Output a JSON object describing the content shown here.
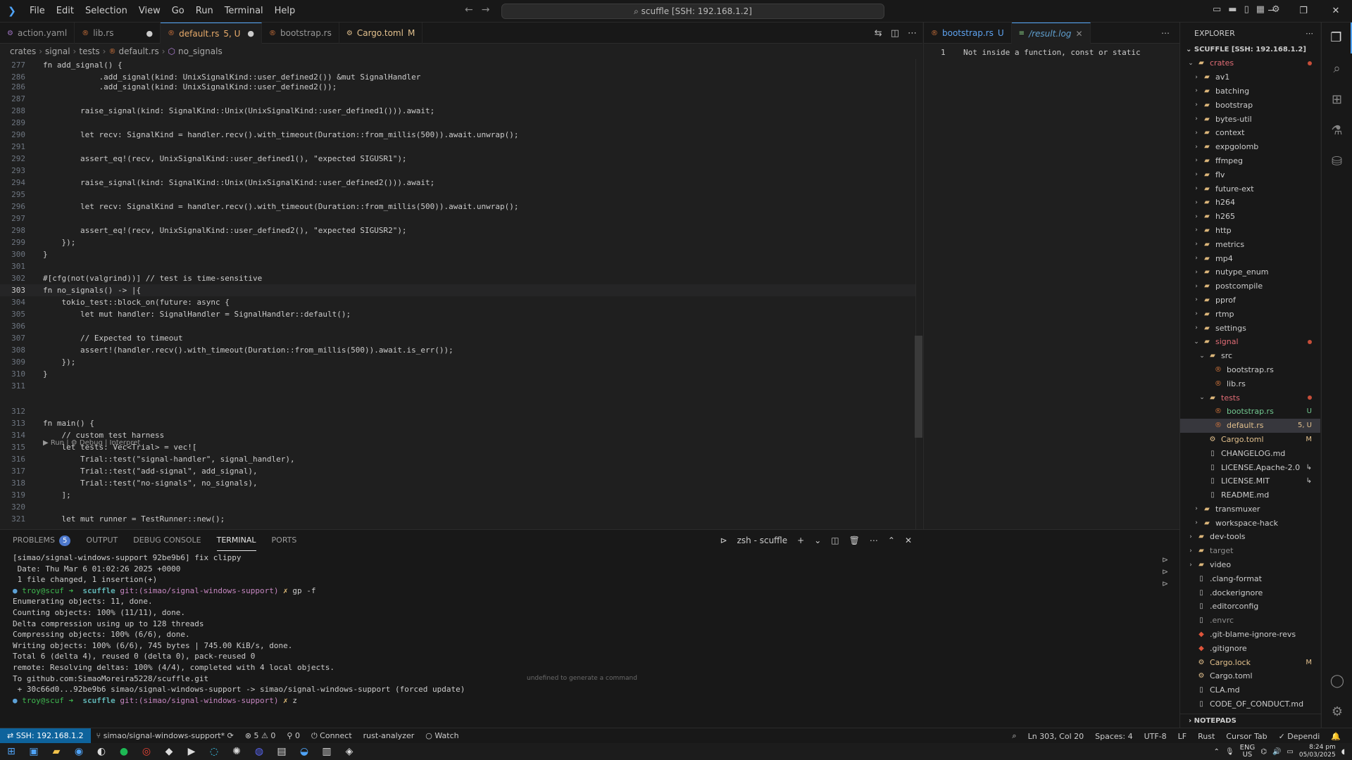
{
  "titlebar": {
    "menu": [
      "File",
      "Edit",
      "Selection",
      "View",
      "Go",
      "Run",
      "Terminal",
      "Help"
    ],
    "command_center": "scuffle [SSH: 192.168.1.2]"
  },
  "editor1": {
    "tabs": [
      {
        "label": "action.yaml",
        "suffix": ""
      },
      {
        "label": "lib.rs",
        "suffix": ""
      },
      {
        "label": "default.rs",
        "suffix": "5, U"
      },
      {
        "label": "bootstrap.rs",
        "suffix": ""
      },
      {
        "label": "Cargo.toml",
        "suffix": "M"
      }
    ],
    "breadcrumb": [
      "crates",
      "signal",
      "tests",
      "default.rs",
      "no_signals"
    ],
    "lines": [
      {
        "n": "277",
        "t": "fn add_signal() {"
      },
      {
        "n": "286",
        "t": "            .add_signal(kind: UnixSignalKind::user_defined2()) &mut SignalHandler"
      },
      {
        "n": "286",
        "t": "            .add_signal(kind: UnixSignalKind::user_defined2());"
      },
      {
        "n": "287",
        "t": ""
      },
      {
        "n": "288",
        "t": "        raise_signal(kind: SignalKind::Unix(UnixSignalKind::user_defined1())).await;"
      },
      {
        "n": "289",
        "t": ""
      },
      {
        "n": "290",
        "t": "        let recv: SignalKind = handler.recv().with_timeout(Duration::from_millis(500)).await.unwrap();"
      },
      {
        "n": "291",
        "t": ""
      },
      {
        "n": "292",
        "t": "        assert_eq!(recv, UnixSignalKind::user_defined1(), \"expected SIGUSR1\");"
      },
      {
        "n": "293",
        "t": ""
      },
      {
        "n": "294",
        "t": "        raise_signal(kind: SignalKind::Unix(UnixSignalKind::user_defined2())).await;"
      },
      {
        "n": "295",
        "t": ""
      },
      {
        "n": "296",
        "t": "        let recv: SignalKind = handler.recv().with_timeout(Duration::from_millis(500)).await.unwrap();"
      },
      {
        "n": "297",
        "t": ""
      },
      {
        "n": "298",
        "t": "        assert_eq!(recv, UnixSignalKind::user_defined2(), \"expected SIGUSR2\");"
      },
      {
        "n": "299",
        "t": "    });"
      },
      {
        "n": "300",
        "t": "}"
      },
      {
        "n": "301",
        "t": ""
      },
      {
        "n": "302",
        "t": "#[cfg(not(valgrind))] // test is time-sensitive"
      },
      {
        "n": "303",
        "t": "fn no_signals() -> |{"
      },
      {
        "n": "304",
        "t": "    tokio_test::block_on(future: async {"
      },
      {
        "n": "305",
        "t": "        let mut handler: SignalHandler = SignalHandler::default();"
      },
      {
        "n": "306",
        "t": ""
      },
      {
        "n": "307",
        "t": "        // Expected to timeout"
      },
      {
        "n": "308",
        "t": "        assert!(handler.recv().with_timeout(Duration::from_millis(500)).await.is_err());"
      },
      {
        "n": "309",
        "t": "    });"
      },
      {
        "n": "310",
        "t": "}"
      },
      {
        "n": "311",
        "t": ""
      },
      {
        "n": "312",
        "t": ""
      },
      {
        "n": "313",
        "t": "fn main() {"
      },
      {
        "n": "314",
        "t": "    // custom test harness"
      },
      {
        "n": "315",
        "t": "    let tests: Vec<Trial> = vec!["
      },
      {
        "n": "316",
        "t": "        Trial::test(\"signal-handler\", signal_handler),"
      },
      {
        "n": "317",
        "t": "        Trial::test(\"add-signal\", add_signal),"
      },
      {
        "n": "318",
        "t": "        Trial::test(\"no-signals\", no_signals),"
      },
      {
        "n": "319",
        "t": "    ];"
      },
      {
        "n": "320",
        "t": ""
      },
      {
        "n": "321",
        "t": "    let mut runner = TestRunner::new();"
      }
    ],
    "codelens": "▶ Run | ⚙ Debug | Interpret"
  },
  "editor2": {
    "tabs": [
      {
        "label": "bootstrap.rs",
        "suffix": "U"
      },
      {
        "label": "/result.log",
        "suffix": ""
      }
    ],
    "line_number": "1",
    "line_text": "Not inside a function, const or static"
  },
  "explorer": {
    "title": "EXPLORER",
    "root": "SCUFFLE [SSH: 192.168.1.2]",
    "items": [
      {
        "label": "crates",
        "depth": 0,
        "kind": "folder-open",
        "badge": "dot",
        "color": "#e06c75"
      },
      {
        "label": "av1",
        "depth": 1,
        "kind": "folder",
        "badge": ""
      },
      {
        "label": "batching",
        "depth": 1,
        "kind": "folder",
        "badge": ""
      },
      {
        "label": "bootstrap",
        "depth": 1,
        "kind": "folder",
        "badge": ""
      },
      {
        "label": "bytes-util",
        "depth": 1,
        "kind": "folder",
        "badge": ""
      },
      {
        "label": "context",
        "depth": 1,
        "kind": "folder",
        "badge": ""
      },
      {
        "label": "expgolomb",
        "depth": 1,
        "kind": "folder",
        "badge": ""
      },
      {
        "label": "ffmpeg",
        "depth": 1,
        "kind": "folder",
        "badge": ""
      },
      {
        "label": "flv",
        "depth": 1,
        "kind": "folder",
        "badge": ""
      },
      {
        "label": "future-ext",
        "depth": 1,
        "kind": "folder",
        "badge": ""
      },
      {
        "label": "h264",
        "depth": 1,
        "kind": "folder",
        "badge": ""
      },
      {
        "label": "h265",
        "depth": 1,
        "kind": "folder",
        "badge": ""
      },
      {
        "label": "http",
        "depth": 1,
        "kind": "folder",
        "badge": ""
      },
      {
        "label": "metrics",
        "depth": 1,
        "kind": "folder",
        "badge": ""
      },
      {
        "label": "mp4",
        "depth": 1,
        "kind": "folder",
        "badge": ""
      },
      {
        "label": "nutype_enum",
        "depth": 1,
        "kind": "folder",
        "badge": ""
      },
      {
        "label": "postcompile",
        "depth": 1,
        "kind": "folder",
        "badge": ""
      },
      {
        "label": "pprof",
        "depth": 1,
        "kind": "folder",
        "badge": ""
      },
      {
        "label": "rtmp",
        "depth": 1,
        "kind": "folder",
        "badge": ""
      },
      {
        "label": "settings",
        "depth": 1,
        "kind": "folder",
        "badge": ""
      },
      {
        "label": "signal",
        "depth": 1,
        "kind": "folder-open",
        "badge": "dot",
        "color": "#e06c75"
      },
      {
        "label": "src",
        "depth": 2,
        "kind": "folder-open",
        "badge": ""
      },
      {
        "label": "bootstrap.rs",
        "depth": 3,
        "kind": "rust",
        "badge": ""
      },
      {
        "label": "lib.rs",
        "depth": 3,
        "kind": "rust",
        "badge": ""
      },
      {
        "label": "tests",
        "depth": 2,
        "kind": "folder-open",
        "badge": "dot",
        "color": "#e06c75"
      },
      {
        "label": "bootstrap.rs",
        "depth": 3,
        "kind": "rust",
        "badge": "U",
        "color": "#73c991"
      },
      {
        "label": "default.rs",
        "depth": 3,
        "kind": "rust",
        "badge": "5, U",
        "color": "#e2c08d"
      },
      {
        "label": "Cargo.toml",
        "depth": 2,
        "kind": "toml",
        "badge": "M",
        "color": "#e2c08d"
      },
      {
        "label": "CHANGELOG.md",
        "depth": 2,
        "kind": "file",
        "badge": ""
      },
      {
        "label": "LICENSE.Apache-2.0",
        "depth": 2,
        "kind": "file",
        "badge": "↳"
      },
      {
        "label": "LICENSE.MIT",
        "depth": 2,
        "kind": "file",
        "badge": "↳"
      },
      {
        "label": "README.md",
        "depth": 2,
        "kind": "file",
        "badge": ""
      },
      {
        "label": "transmuxer",
        "depth": 1,
        "kind": "folder",
        "badge": ""
      },
      {
        "label": "workspace-hack",
        "depth": 1,
        "kind": "folder",
        "badge": ""
      },
      {
        "label": "dev-tools",
        "depth": 0,
        "kind": "folder",
        "badge": ""
      },
      {
        "label": "target",
        "depth": 0,
        "kind": "folder",
        "badge": "",
        "color": "#8c8c8c"
      },
      {
        "label": "video",
        "depth": 0,
        "kind": "folder",
        "badge": ""
      },
      {
        "label": ".clang-format",
        "depth": 0,
        "kind": "file",
        "badge": ""
      },
      {
        "label": ".dockerignore",
        "depth": 0,
        "kind": "file",
        "badge": ""
      },
      {
        "label": ".editorconfig",
        "depth": 0,
        "kind": "file",
        "badge": ""
      },
      {
        "label": ".envrc",
        "depth": 0,
        "kind": "file",
        "badge": "",
        "color": "#8c8c8c"
      },
      {
        "label": ".git-blame-ignore-revs",
        "depth": 0,
        "kind": "git",
        "badge": ""
      },
      {
        "label": ".gitignore",
        "depth": 0,
        "kind": "git",
        "badge": ""
      },
      {
        "label": "Cargo.lock",
        "depth": 0,
        "kind": "toml",
        "badge": "M",
        "color": "#e2c08d"
      },
      {
        "label": "Cargo.toml",
        "depth": 0,
        "kind": "toml",
        "badge": ""
      },
      {
        "label": "CLA.md",
        "depth": 0,
        "kind": "file",
        "badge": ""
      },
      {
        "label": "CODE_OF_CONDUCT.md",
        "depth": 0,
        "kind": "file",
        "badge": ""
      }
    ],
    "notepads": "NOTEPADS"
  },
  "panel": {
    "tabs": [
      "PROBLEMS",
      "OUTPUT",
      "DEBUG CONSOLE",
      "TERMINAL",
      "PORTS"
    ],
    "problems_count": "5",
    "terminal_name": "zsh - scuffle",
    "lines": [
      "[simao/signal-windows-support 92be9b6] fix clippy",
      " Date: Thu Mar 6 01:02:26 2025 +0000",
      " 1 file changed, 1 insertion(+)",
      "PROMPT1",
      "Enumerating objects: 11, done.",
      "Counting objects: 100% (11/11), done.",
      "Delta compression using up to 128 threads",
      "Compressing objects: 100% (6/6), done.",
      "Writing objects: 100% (6/6), 745 bytes | 745.00 KiB/s, done.",
      "Total 6 (delta 4), reused 0 (delta 0), pack-reused 0",
      "remote: Resolving deltas: 100% (4/4), completed with 4 local objects.",
      "To github.com:SimaoMoreira5228/scuffle.git",
      " + 30c66d0...92be9b6 simao/signal-windows-support -> simao/signal-windows-support (forced update)",
      "PROMPT2"
    ],
    "prompt_user": "troy@scuf",
    "prompt_dir": "scuffle",
    "prompt_git": "git:(simao/signal-windows-support)",
    "prompt1_cmd": "gp -f",
    "prompt2_cmd": "z",
    "hint": "undefined to generate a command"
  },
  "status": {
    "remote": "SSH: 192.168.1.2",
    "branch": "simao/signal-windows-support*",
    "problems": "⊗ 5 ⚠ 0",
    "ports": "⚲ 0",
    "connect": "Connect",
    "analyzer": "rust-analyzer",
    "watch": "Watch",
    "position": "Ln 303, Col 20",
    "spaces": "Spaces: 4",
    "encoding": "UTF-8",
    "eol": "LF",
    "language": "Rust",
    "cursor_tab": "Cursor Tab",
    "dependi": "Dependi"
  },
  "taskbar": {
    "lang": "ENG",
    "region": "US",
    "time": "8:24 pm",
    "date": "05/03/2025"
  }
}
